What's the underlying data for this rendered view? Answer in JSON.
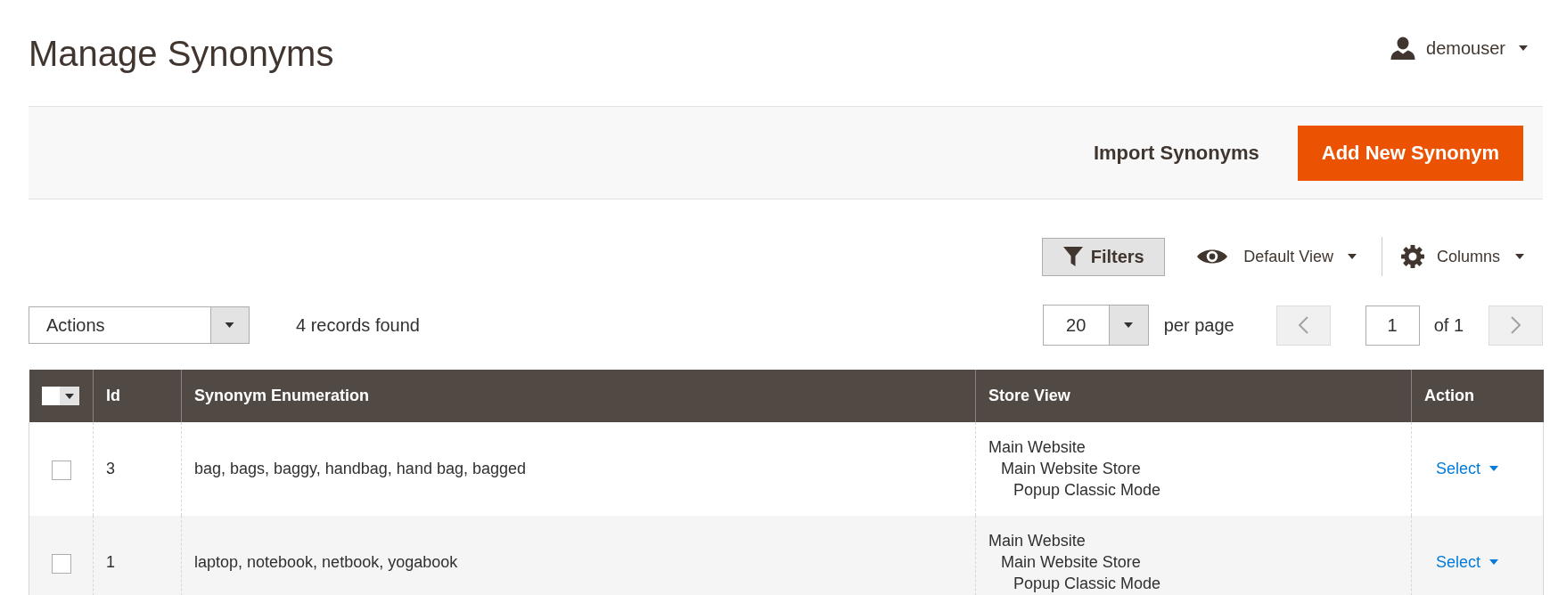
{
  "page_title": "Manage Synonyms",
  "user_menu": {
    "name": "demouser"
  },
  "page_actions": [
    {
      "label": "Import Synonyms",
      "kind": "secondary"
    },
    {
      "label": "Add New Synonym",
      "kind": "primary"
    }
  ],
  "grid_toolbar": {
    "filters": {
      "label": "Filters"
    },
    "view": {
      "label": "Default View"
    },
    "columns": {
      "label": "Columns"
    }
  },
  "mass_actions": {
    "label": "Actions"
  },
  "records_found": "4 records found",
  "pagination": {
    "per_page": "20",
    "per_page_label": "per page",
    "previous": {
      "disabled": true
    },
    "page": "1",
    "total": "of 1",
    "next": {
      "disabled": true
    }
  },
  "table": {
    "select_all": {
      "checked": false
    },
    "columns": [
      "Id",
      "Synonym Enumeration",
      "Store View",
      "Action"
    ],
    "rows": [
      {
        "checked": false,
        "id": "3",
        "synonyms": "bag, bags, baggy, handbag, hand bag, bagged",
        "store_view": [
          {
            "label": "Main Website",
            "children": [
              {
                "label": "Main Website Store",
                "children": [
                  {
                    "label": "Popup Classic Mode"
                  }
                ]
              }
            ]
          }
        ],
        "action": "Select"
      },
      {
        "checked": false,
        "id": "1",
        "synonyms": "laptop, notebook, netbook, yogabook",
        "store_view": [
          {
            "label": "Main Website",
            "children": [
              {
                "label": "Main Website Store",
                "children": [
                  {
                    "label": "Popup Classic Mode"
                  }
                ]
              }
            ]
          }
        ],
        "action": "Select"
      }
    ]
  }
}
